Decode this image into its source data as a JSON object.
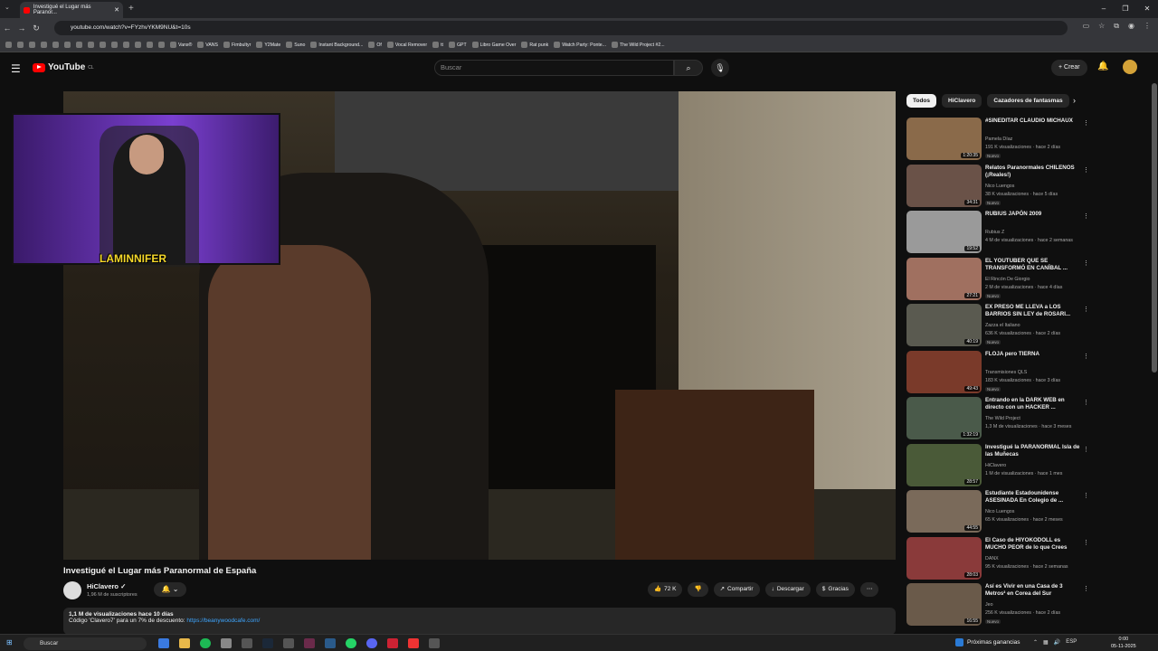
{
  "browser": {
    "tab_title": "Investigué el Lugar más Paranor...",
    "url": "youtube.com/watch?v=FYzhvYKM9NU&t=10s",
    "bookmarks": [
      "Vans®",
      "VANS",
      "Fimbultyr",
      "Y2Mate",
      "Suno",
      "Instant Background...",
      "Of",
      "Vocal Remover",
      "tt",
      "GPT",
      "Libro Game Over",
      "Rat punk",
      "Watch Party: Ponte...",
      "The Wild Project #2..."
    ]
  },
  "youtube": {
    "logo_text": "YouTube",
    "region": "CL",
    "search_placeholder": "Buscar",
    "create_label": "Crear"
  },
  "video": {
    "streamer_tag": "LAMINNIFER",
    "title": "Investigué el Lugar más Paranormal de España",
    "channel": "HiClavero",
    "subscribers": "1,96 M de suscriptores",
    "likes": "72 K",
    "share_label": "Compartir",
    "download_label": "Descargar",
    "thanks_label": "Gracias",
    "views_date": "1,1 M de visualizaciones  hace 10 días",
    "promo_text": "Código 'Clavero7' para un 7% de descuento: ",
    "promo_link": "https://beanywoodcafe.com/"
  },
  "chips": [
    "Todos",
    "HiClavero",
    "Cazadores de fantasmas"
  ],
  "recommendations": [
    {
      "title": "#SINEDITAR CLAUDIO MICHAUX",
      "channel": "Pamela Díaz",
      "meta": "191 K visualizaciones · hace 2 días",
      "badge": "Nuevo",
      "duration": "1:20:35",
      "color": "#8a6a4a"
    },
    {
      "title": "Relatos Paranormales CHILENOS (¡Reales!)",
      "channel": "Nico Luengos",
      "meta": "38 K visualizaciones · hace 5 días",
      "badge": "Nuevo",
      "duration": "34:31",
      "color": "#6a5248"
    },
    {
      "title": "RUBIUS JAPÓN 2009",
      "channel": "Rubius Z",
      "meta": "4 M de visualizaciones · hace 2 semanas",
      "badge": "",
      "duration": "19:52",
      "color": "#9a9a9a"
    },
    {
      "title": "EL YOUTUBER QUE SE TRANSFORMÓ EN CANÍBAL ...",
      "channel": "El Rincón De Giorgio",
      "meta": "2 M de visualizaciones · hace 4 días",
      "badge": "Nuevo",
      "duration": "27:21",
      "color": "#a07060"
    },
    {
      "title": "EX PRESO ME LLEVA a LOS BARRIOS SIN LEY de ROSARI...",
      "channel": "Zazza el Italiano",
      "meta": "636 K visualizaciones · hace 2 días",
      "badge": "Nuevo",
      "duration": "40:19",
      "color": "#5a5a50"
    },
    {
      "title": "FLOJA pero TIERNA",
      "channel": "Transmisiones QLS",
      "meta": "183 K visualizaciones · hace 3 días",
      "badge": "Nuevo",
      "duration": "49:43",
      "color": "#7a3a2a"
    },
    {
      "title": "Entrando en la DARK WEB en directo con un HACKER ...",
      "channel": "The Wild Project",
      "meta": "1,3 M de visualizaciones · hace 3 meses",
      "badge": "",
      "duration": "1:32:19",
      "color": "#4a5a4a"
    },
    {
      "title": "Investigué la PARANORMAL Isla de las Muñecas",
      "channel": "HiClavero",
      "meta": "1 M de visualizaciones · hace 1 mes",
      "badge": "",
      "duration": "28:57",
      "color": "#4a5a38"
    },
    {
      "title": "Estudiante Estadounidense ASESINADA En Colegio de ...",
      "channel": "Nico Luengos",
      "meta": "65 K visualizaciones · hace 2 meses",
      "badge": "",
      "duration": "44:55",
      "color": "#7a6a5a"
    },
    {
      "title": "El Caso de HIYOKODOLL es MUCHO PEOR de lo que Crees",
      "channel": "DANX",
      "meta": "95 K visualizaciones · hace 2 semanas",
      "badge": "",
      "duration": "28:03",
      "color": "#8a3a3a"
    },
    {
      "title": "Así es Vivir en una Casa de 3 Metros² en Corea del Sur",
      "channel": "Jeo",
      "meta": "256 K visualizaciones · hace 2 días",
      "badge": "Nuevo",
      "duration": "16:55",
      "color": "#6a5a4a"
    }
  ],
  "taskbar": {
    "search_placeholder": "Buscar",
    "news": "Próximas ganancias",
    "lang": "ESP",
    "time": "0:00",
    "date": "05-11-2025"
  }
}
